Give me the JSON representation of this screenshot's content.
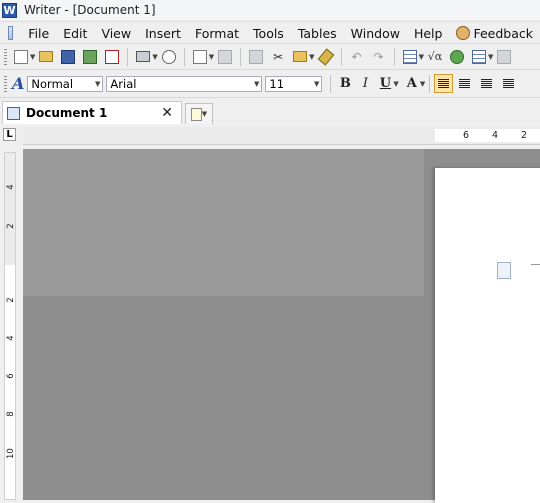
{
  "window": {
    "app_icon_letter": "W",
    "title": "Writer - [Document 1]"
  },
  "menu": {
    "items": [
      "File",
      "Edit",
      "View",
      "Insert",
      "Format",
      "Tools",
      "Tables",
      "Window",
      "Help"
    ],
    "feedback": "Feedback"
  },
  "format_toolbar": {
    "paragraph_style": "Normal",
    "font_name": "Arial",
    "font_size": "11",
    "bold": "B",
    "italic": "I",
    "underline": "U",
    "font_color_glyph": "A",
    "styles_glyph": "A"
  },
  "standard_toolbar": {
    "formula_glyph": "√α"
  },
  "tabs": {
    "document_tab": "Document 1",
    "close_glyph": "✕"
  },
  "ruler": {
    "corner_glyph": "L",
    "horizontal_numbers": [
      "6",
      "4",
      "2"
    ],
    "vertical_numbers": [
      "4",
      "2",
      "2",
      "4",
      "6",
      "8",
      "10"
    ]
  }
}
